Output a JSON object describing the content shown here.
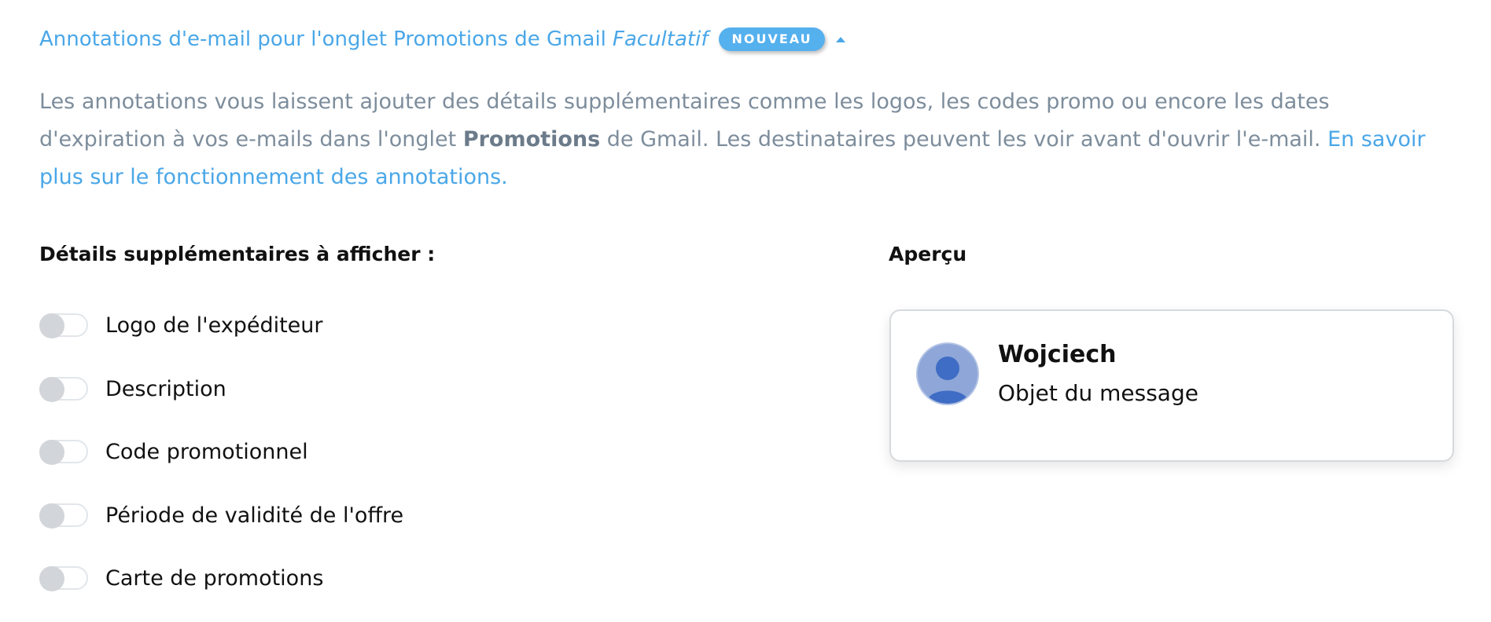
{
  "header": {
    "title": "Annotations d'e-mail pour l'onglet Promotions de Gmail",
    "optional": "Facultatif",
    "badge": "NOUVEAU",
    "caret_icon": "caret-up-icon"
  },
  "intro": {
    "part1": "Les annotations vous laissent ajouter des détails supplémentaires comme les logos, les codes promo ou encore les dates d'expiration à vos e-mails dans l'onglet ",
    "bold": "Promotions",
    "part2": " de Gmail. Les destinataires peuvent les voir avant d'ouvrir l'e-mail. ",
    "link": "En savoir plus sur le fonctionnement des annotations."
  },
  "details": {
    "heading": "Détails supplémentaires à afficher :",
    "options": [
      {
        "label": "Logo de l'expéditeur",
        "enabled": false
      },
      {
        "label": "Description",
        "enabled": false
      },
      {
        "label": "Code promotionnel",
        "enabled": false
      },
      {
        "label": "Période de validité de l'offre",
        "enabled": false
      },
      {
        "label": "Carte de promotions",
        "enabled": false
      }
    ]
  },
  "preview": {
    "heading": "Aperçu",
    "avatar_icon": "user-avatar-icon",
    "sender": "Wojciech",
    "subject": "Objet du message"
  },
  "colors": {
    "link": "#4aa7e8",
    "badge": "#55b0ee",
    "body_text": "#7d8d9c",
    "avatar_bg": "#8ea6d8",
    "avatar_figure": "#3f6cc4",
    "toggle_knob": "#d2d6da"
  }
}
